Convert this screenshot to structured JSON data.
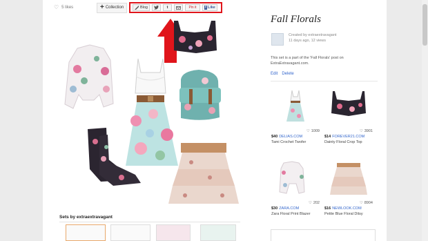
{
  "toolbar": {
    "likes": "5 likes",
    "collection_label": "Collection",
    "share": {
      "blog": "Blog",
      "twitter": "t",
      "tumblr": "t",
      "pinit": "Pin it",
      "fb_like": "Like"
    }
  },
  "set": {
    "title": "Fall Florals",
    "created_by": "Created by extraextravagant",
    "created_ago": "11 days ago, 12 views",
    "description": "This set is a part of the 'Fall Florals' post on ExtraExtravagant.com.",
    "edit": "Edit",
    "delete": "Delete"
  },
  "items": [
    {
      "likes": "1009",
      "price": "$40",
      "store": "DELIAS.COM",
      "name": "Tami Crochet Twofer"
    },
    {
      "likes": "3901",
      "price": "$14",
      "store": "FOREVER21.COM",
      "name": "Dainty Floral Crop Top"
    },
    {
      "likes": "202",
      "price": "$30",
      "store": "ZARA.COM",
      "name": "Zara Floral Print Blazer"
    },
    {
      "likes": "8904",
      "price": "$16",
      "store": "NEWLOOK.COM",
      "name": "Petite Blue Floral Ditsy"
    }
  ],
  "sets": {
    "title": "Sets by extraextravagant"
  },
  "colors": {
    "highlight": "#e0151b",
    "link": "#3366cc"
  }
}
